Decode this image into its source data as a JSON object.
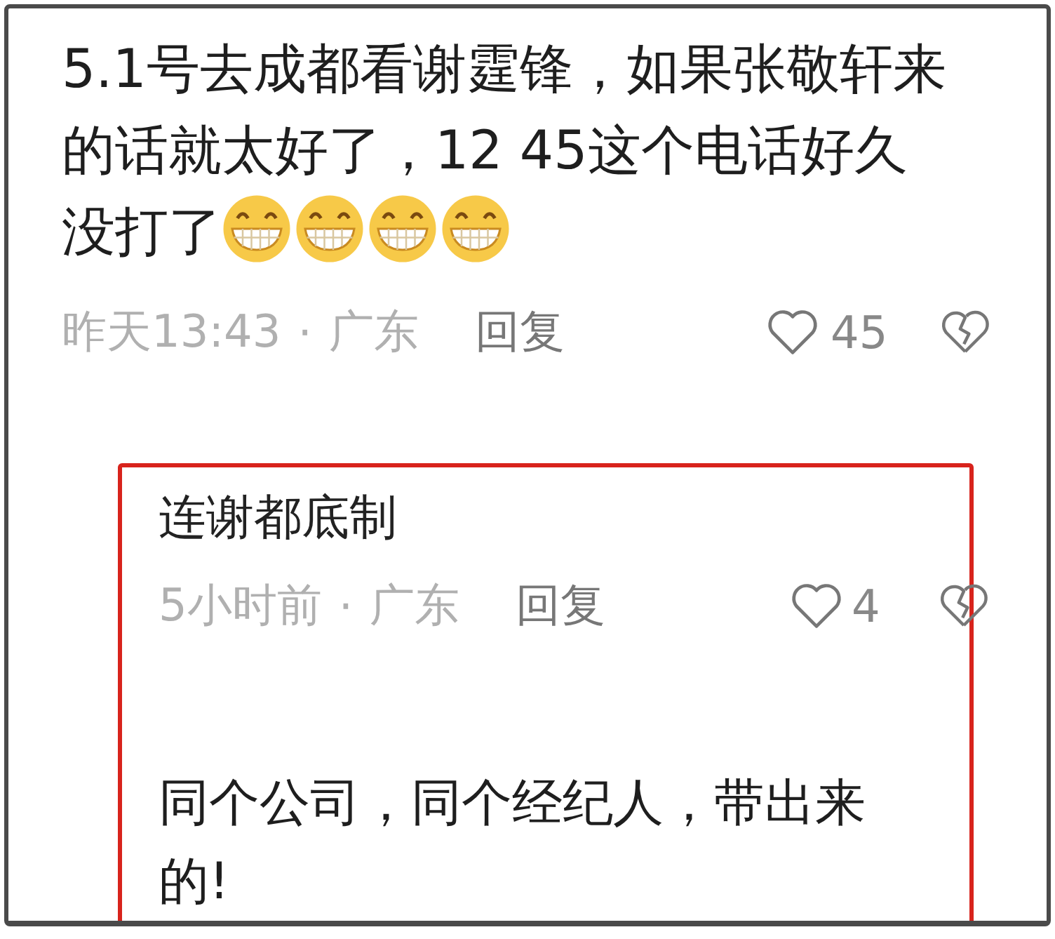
{
  "comment": {
    "lines": [
      "5.1号去成都看谢霆锋，如果张敬轩来",
      "的话就太好了，12 45这个电话好久",
      "没打了"
    ],
    "emojis": [
      {
        "kind": "grin"
      },
      {
        "kind": "grin"
      },
      {
        "kind": "grin"
      },
      {
        "kind": "grin"
      }
    ],
    "time": "昨天13:43",
    "separator": "·",
    "location": "广东",
    "reply": "回复",
    "likes": "45"
  },
  "reply": {
    "highlighted": true,
    "text": "连谢都底制",
    "time": "5小时前",
    "separator": "·",
    "location": "广东",
    "reply": "回复",
    "likes": "4",
    "next_text": "同个公司，同个经纪人，带出来的!"
  }
}
